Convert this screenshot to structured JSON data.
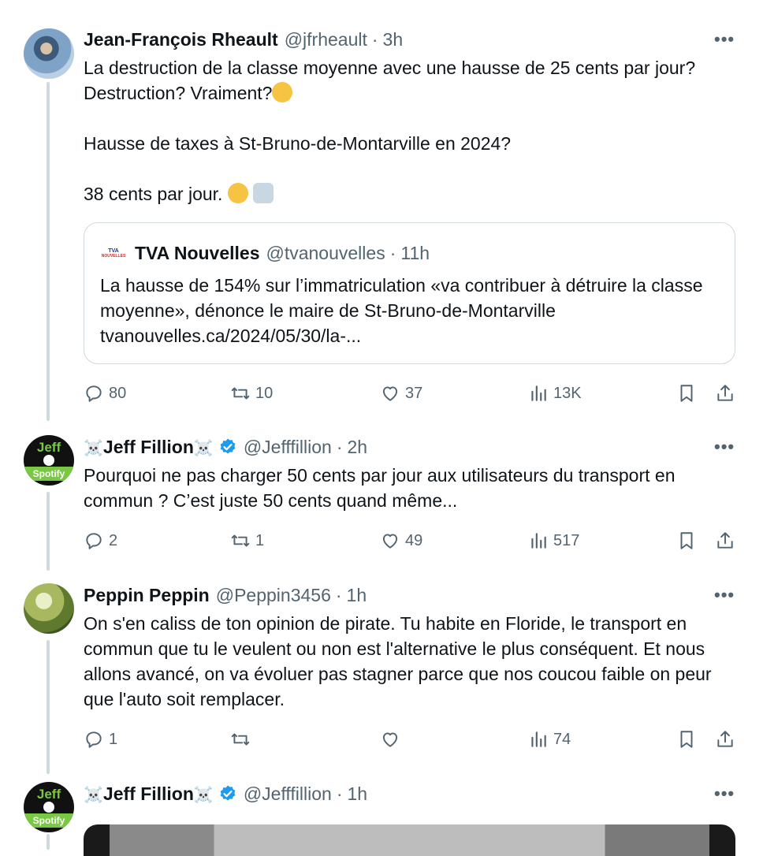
{
  "tweets": [
    {
      "name": "Jean-François Rheault",
      "handle": "@jfrheault",
      "dot": "·",
      "time": "3h",
      "more": "•••",
      "lines": [
        "La destruction de la classe moyenne avec une hausse de 25 cents par jour?",
        "Destruction? Vraiment?",
        "",
        "Hausse de taxes à St-Bruno-de-Montarville en 2024?",
        "",
        "38 cents par jour."
      ],
      "quote": {
        "logo_top": "TVA",
        "logo_bottom": "NOUVELLES",
        "name": "TVA Nouvelles",
        "handle": "@tvanouvelles",
        "dot": "·",
        "time": "11h",
        "text": "La hausse de 154% sur l’immatriculation «va contribuer à détruire la classe moyenne», dénonce le maire de St-Bruno-de-Montarville tvanouvelles.ca/2024/05/30/la-..."
      },
      "stats": {
        "replies": "80",
        "reposts": "10",
        "likes": "37",
        "views": "13K"
      }
    },
    {
      "name": "Jeff Fillion",
      "name_prefix": "☠️",
      "name_suffix": "☠️",
      "handle": "@Jefffillion",
      "dot": "·",
      "time": "2h",
      "more": "•••",
      "text": "Pourquoi ne pas charger 50 cents par jour aux utilisateurs du transport en commun ? C’est juste 50 cents quand même...",
      "avatar_top": "Jeff",
      "avatar_bottom": "Spotify",
      "stats": {
        "replies": "2",
        "reposts": "1",
        "likes": "49",
        "views": "517"
      }
    },
    {
      "name": "Peppin Peppin",
      "handle": "@Peppin3456",
      "dot": "·",
      "time": "1h",
      "more": "•••",
      "text": "On s'en caliss de ton opinion de pirate. Tu habite en Floride, le transport en commun que tu le veulent ou non est l'alternative le plus conséquent. Et nous allons avancé, on va évoluer pas stagner parce que nos coucou faible on peur que l'auto soit remplacer.",
      "stats": {
        "replies": "1",
        "reposts": "",
        "likes": "",
        "views": "74"
      }
    },
    {
      "name": "Jeff Fillion",
      "name_prefix": "☠️",
      "name_suffix": "☠️",
      "handle": "@Jefffillion",
      "dot": "·",
      "time": "1h",
      "more": "•••",
      "avatar_top": "Jeff",
      "avatar_bottom": "Spotify"
    }
  ],
  "colors": {
    "text": "#0f1419",
    "muted": "#536471",
    "verified": "#1d9bf0",
    "thread_line": "#cfd9de"
  }
}
